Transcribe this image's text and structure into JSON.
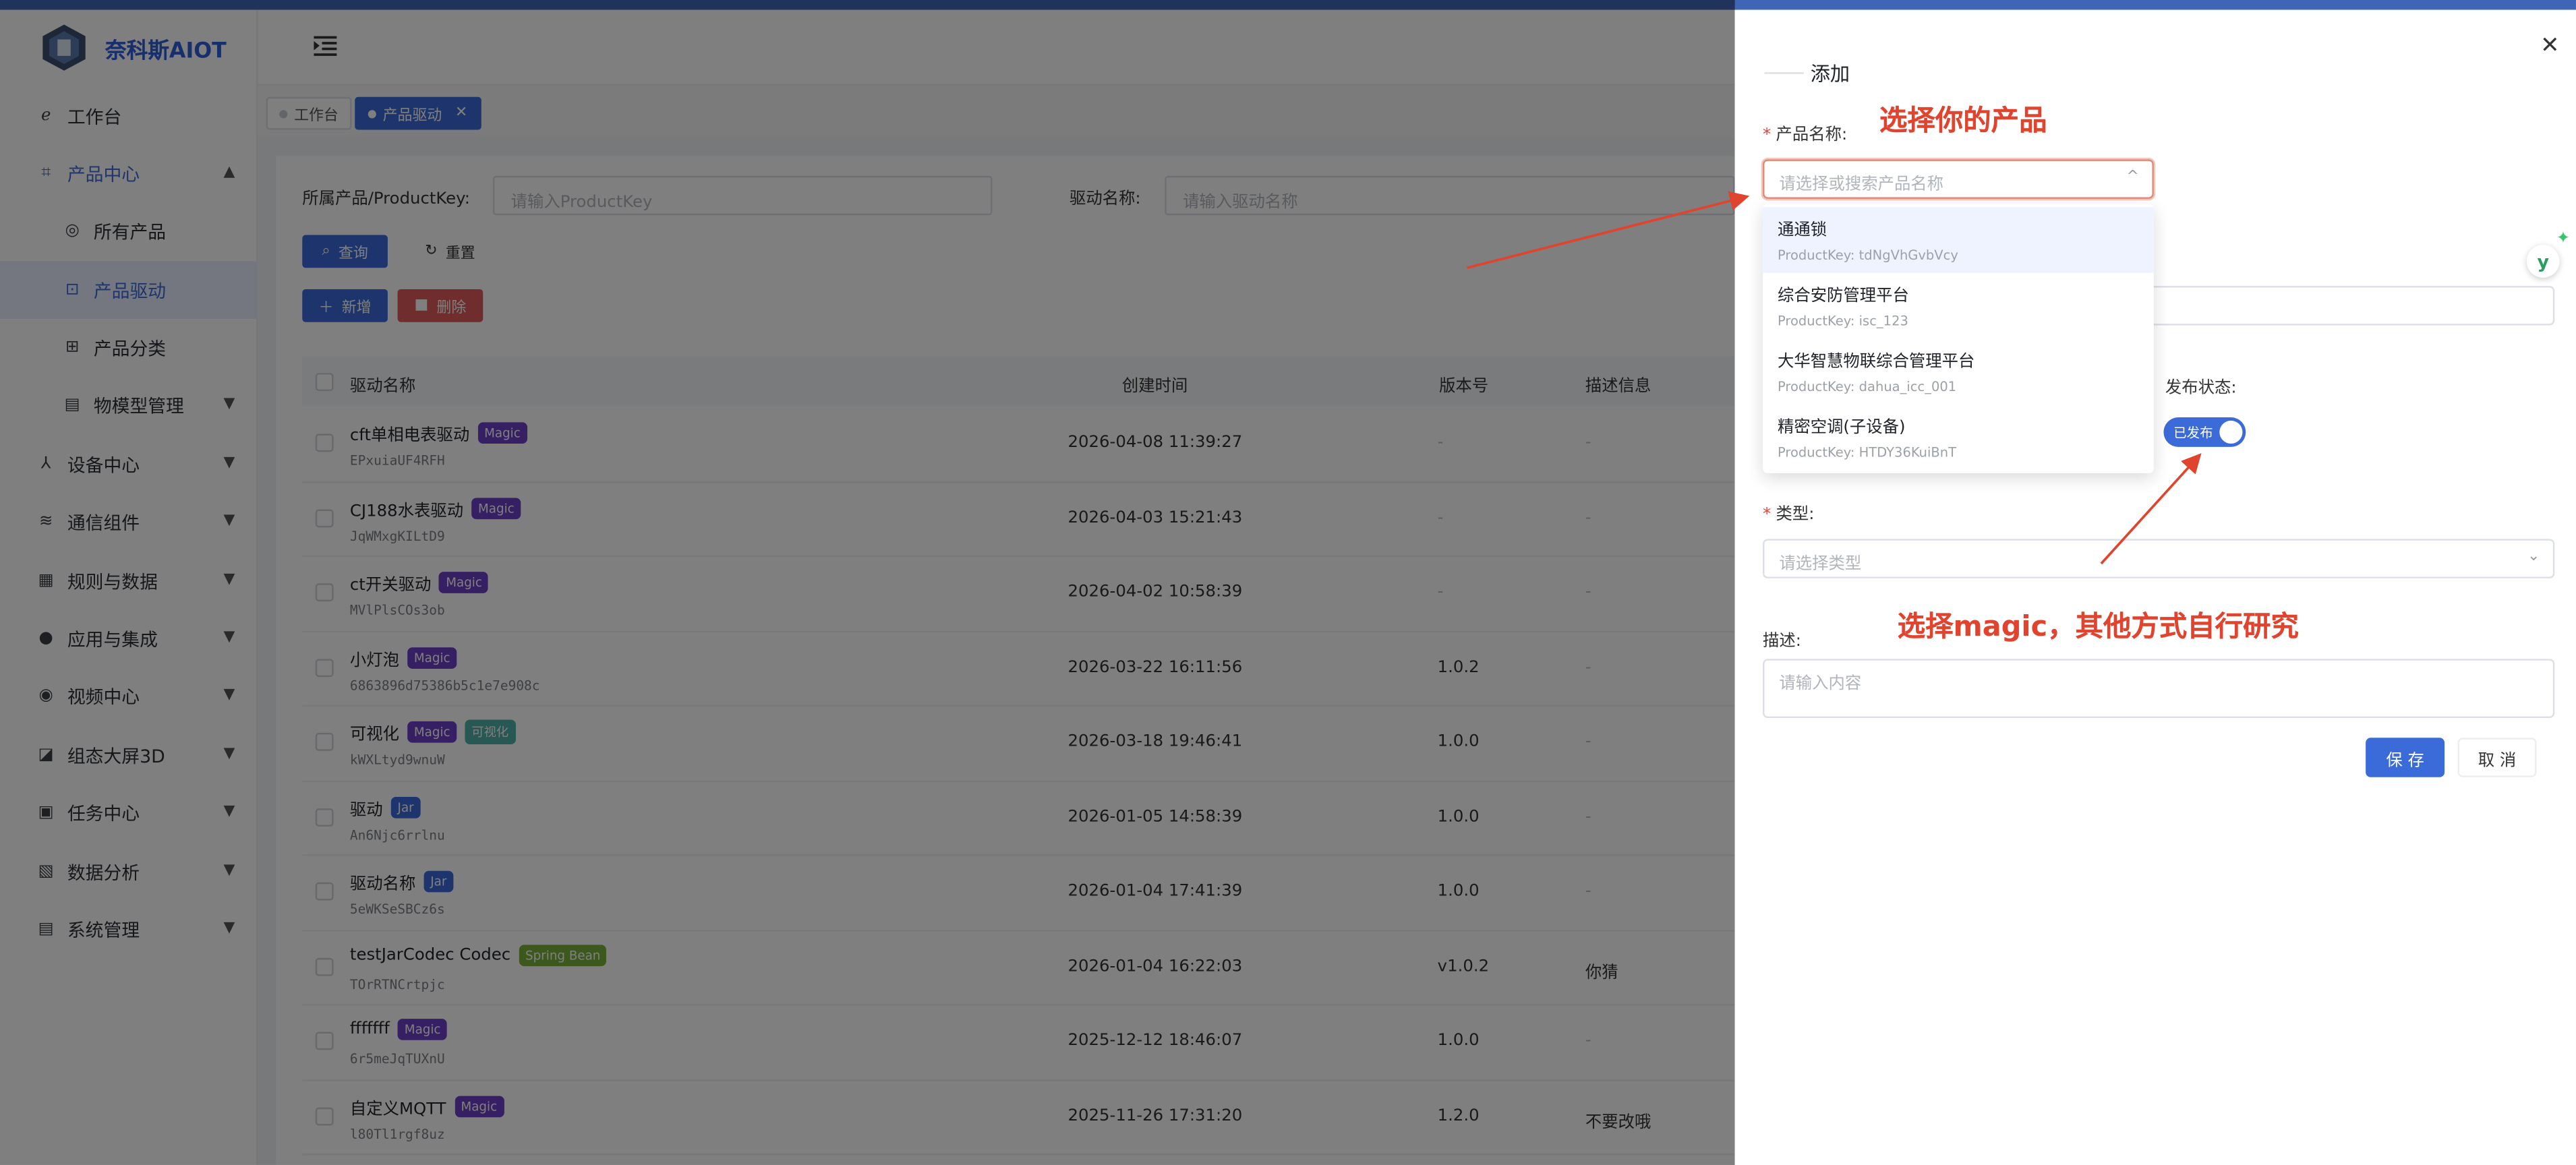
{
  "brand": {
    "name": "奈科斯AIOT"
  },
  "sidebar": {
    "items": [
      {
        "label": "工作台",
        "icon": "dashboard-icon"
      },
      {
        "label": "产品中心",
        "icon": "product-icon"
      },
      {
        "label": "所有产品",
        "icon": "circle-dot-icon"
      },
      {
        "label": "产品驱动",
        "icon": "driver-icon"
      },
      {
        "label": "产品分类",
        "icon": "grid-icon"
      },
      {
        "label": "物模型管理",
        "icon": "list-icon"
      },
      {
        "label": "设备中心",
        "icon": "device-icon"
      },
      {
        "label": "通信组件",
        "icon": "wifi-icon"
      },
      {
        "label": "规则与数据",
        "icon": "rule-icon"
      },
      {
        "label": "应用与集成",
        "icon": "app-icon"
      },
      {
        "label": "视频中心",
        "icon": "eye-icon"
      },
      {
        "label": "组态大屏3D",
        "icon": "chart-icon"
      },
      {
        "label": "任务中心",
        "icon": "task-icon"
      },
      {
        "label": "数据分析",
        "icon": "analysis-icon"
      },
      {
        "label": "系统管理",
        "icon": "system-icon"
      }
    ]
  },
  "tabs": [
    {
      "label": "工作台"
    },
    {
      "label": "产品驱动"
    }
  ],
  "filters": {
    "product_label": "所属产品/ProductKey:",
    "product_placeholder": "请输入ProductKey",
    "driver_label": "驱动名称:",
    "driver_placeholder": "请输入驱动名称"
  },
  "toolbar": {
    "query": "查询",
    "reset": "重置",
    "add": "新增",
    "delete": "删除"
  },
  "table": {
    "headers": {
      "name": "驱动名称",
      "time": "创建时间",
      "version": "版本号",
      "desc": "描述信息"
    },
    "rows": [
      {
        "name": "cft单相电表驱动",
        "tags": [
          {
            "text": "Magic",
            "kind": "magic"
          }
        ],
        "key": "EPxuiaUF4RFH",
        "time": "2026-04-08 11:39:27",
        "version": "-",
        "desc": "-"
      },
      {
        "name": "CJ188水表驱动",
        "tags": [
          {
            "text": "Magic",
            "kind": "magic"
          }
        ],
        "key": "JqWMxgKILtD9",
        "time": "2026-04-03 15:21:43",
        "version": "-",
        "desc": "-"
      },
      {
        "name": "ct开关驱动",
        "tags": [
          {
            "text": "Magic",
            "kind": "magic"
          }
        ],
        "key": "MVlPlsCOs3ob",
        "time": "2026-04-02 10:58:39",
        "version": "-",
        "desc": "-"
      },
      {
        "name": "小灯泡",
        "tags": [
          {
            "text": "Magic",
            "kind": "magic"
          }
        ],
        "key": "6863896d75386b5c1e7e908c",
        "time": "2026-03-22 16:11:56",
        "version": "1.0.2",
        "desc": "-"
      },
      {
        "name": "可视化",
        "tags": [
          {
            "text": "Magic",
            "kind": "magic"
          },
          {
            "text": "可视化",
            "kind": "vis"
          }
        ],
        "key": "kWXLtyd9wnuW",
        "time": "2026-03-18 19:46:41",
        "version": "1.0.0",
        "desc": "-"
      },
      {
        "name": "驱动",
        "tags": [
          {
            "text": "Jar",
            "kind": "jar"
          }
        ],
        "key": "An6Njc6rrlnu",
        "time": "2026-01-05 14:58:39",
        "version": "1.0.0",
        "desc": "-"
      },
      {
        "name": "驱动名称",
        "tags": [
          {
            "text": "Jar",
            "kind": "jar"
          }
        ],
        "key": "5eWKSeSBCz6s",
        "time": "2026-01-04 17:41:39",
        "version": "1.0.0",
        "desc": "-"
      },
      {
        "name": "testJarCodec Codec",
        "tags": [
          {
            "text": "Spring Bean",
            "kind": "spring"
          }
        ],
        "key": "TOrRTNCrtpjc",
        "time": "2026-01-04 16:22:03",
        "version": "v1.0.2",
        "desc": "你猜"
      },
      {
        "name": "fffffff",
        "tags": [
          {
            "text": "Magic",
            "kind": "magic"
          }
        ],
        "key": "6r5meJqTUXnU",
        "time": "2025-12-12 18:46:07",
        "version": "1.0.0",
        "desc": "-"
      },
      {
        "name": "自定义MQTT",
        "tags": [
          {
            "text": "Magic",
            "kind": "magic"
          }
        ],
        "key": "l80Tl1rgf8uz",
        "time": "2025-11-26 17:31:20",
        "version": "1.2.0",
        "desc": "不要改哦"
      }
    ]
  },
  "drawer": {
    "title": "添加",
    "product_label": "产品名称:",
    "product_placeholder": "请选择或搜索产品名称",
    "options": [
      {
        "name": "通通锁",
        "key": "ProductKey: tdNgVhGvbVcy"
      },
      {
        "name": "综合安防管理平台",
        "key": "ProductKey: isc_123"
      },
      {
        "name": "大华智慧物联综合管理平台",
        "key": "ProductKey: dahua_icc_001"
      },
      {
        "name": "精密空调(子设备)",
        "key": "ProductKey: HTDY36KuiBnT"
      }
    ],
    "publish_label": "发布状态:",
    "publish_value": "已发布",
    "type_label": "类型:",
    "type_placeholder": "请选择类型",
    "desc_label": "描述:",
    "desc_placeholder": "请输入内容",
    "save": "保 存",
    "cancel": "取 消"
  },
  "annotations": {
    "select_product": "选择你的产品",
    "select_magic": "选择magic，其他方式自行研究"
  },
  "colors": {
    "primary": "#3b6bd9",
    "danger": "#e05a5a",
    "annotation": "#e0442f",
    "magic_tag": "#6d3fc7"
  }
}
